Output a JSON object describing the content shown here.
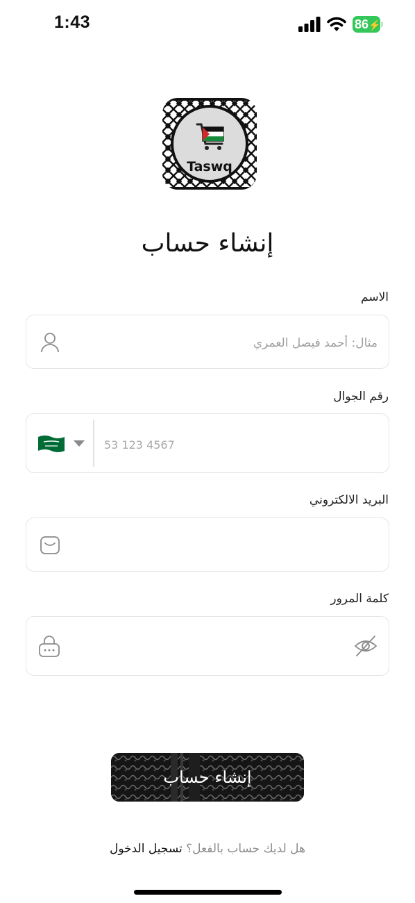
{
  "status_bar": {
    "time": "1:43",
    "battery_level": "86"
  },
  "logo": {
    "text": "Taswq"
  },
  "page": {
    "title": "إنشاء حساب"
  },
  "form": {
    "name": {
      "label": "الاسم",
      "placeholder": "مثال: أحمد فيصل العمري",
      "value": ""
    },
    "phone": {
      "label": "رقم الجوال",
      "placeholder": "53 123 4567",
      "value": "",
      "country_flag": "saudi-arabia-flag"
    },
    "email": {
      "label": "البريد الالكتروني",
      "placeholder": "",
      "value": ""
    },
    "password": {
      "label": "كلمة المرور",
      "placeholder": "",
      "value": ""
    }
  },
  "actions": {
    "submit_label": "إنشاء حساب"
  },
  "footer": {
    "question": "هل لديك حساب بالفعل؟",
    "login_link": "تسجيل الدخول"
  },
  "colors": {
    "accent_green": "#006c35",
    "battery_green": "#34c759",
    "button_dark": "#1b1b1b",
    "placeholder_gray": "#9e9e9e"
  }
}
